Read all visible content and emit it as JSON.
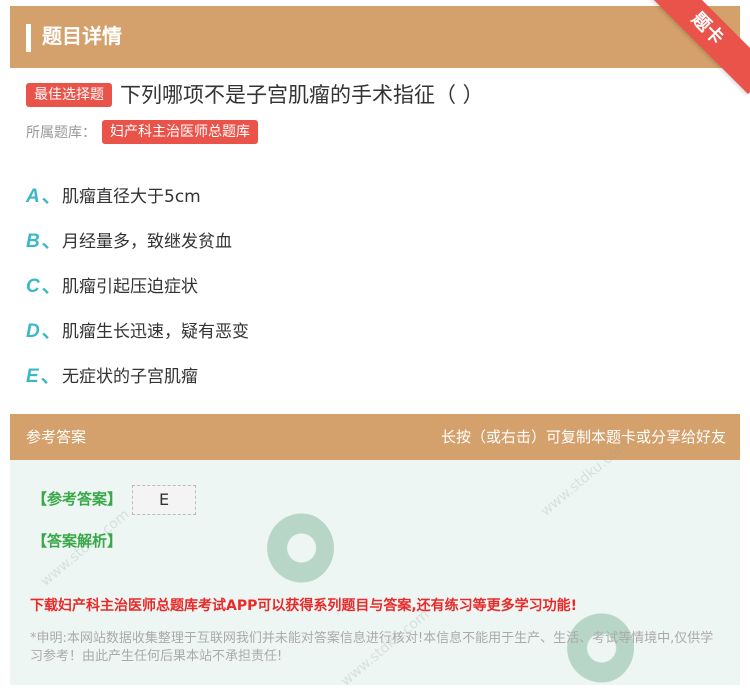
{
  "header": {
    "title": "题目详情",
    "ribbon": "题卡"
  },
  "question": {
    "type_tag": "最佳选择题",
    "text": "下列哪项不是子宫肌瘤的手术指征（ ）",
    "bank_label": "所属题库：",
    "bank_name": "妇产科主治医师总题库"
  },
  "options": [
    {
      "letter": "A",
      "sep": "、",
      "text": "肌瘤直径大于5cm"
    },
    {
      "letter": "B",
      "sep": "、",
      "text": "月经量多，致继发贫血"
    },
    {
      "letter": "C",
      "sep": "、",
      "text": "肌瘤引起压迫症状"
    },
    {
      "letter": "D",
      "sep": "、",
      "text": "肌瘤生长迅速，疑有恶变"
    },
    {
      "letter": "E",
      "sep": "、",
      "text": "无症状的子宫肌瘤"
    }
  ],
  "answer": {
    "section_title": "参考答案",
    "share_hint": "长按（或右击）可复制本题卡或分享给好友",
    "answer_label": "【参考答案】",
    "answer_value": "E",
    "analysis_label": "【答案解析】",
    "promo": "下载妇产科主治医师总题库考试APP可以获得系列题目与答案,还有练习等更多学习功能!",
    "disclaimer": "*申明:本网站数据收集整理于互联网我们并未能对答案信息进行核对!本信息不能用于生产、生活、考试等情境中,仅供学习参考！由此产生任何后果本站不承担责任!"
  },
  "colors": {
    "header_bg": "#d4a06b",
    "accent_red": "#e9534a",
    "option_letter": "#3bb8c8",
    "answer_green": "#3aa84a",
    "promo_red": "#e82a2a"
  }
}
